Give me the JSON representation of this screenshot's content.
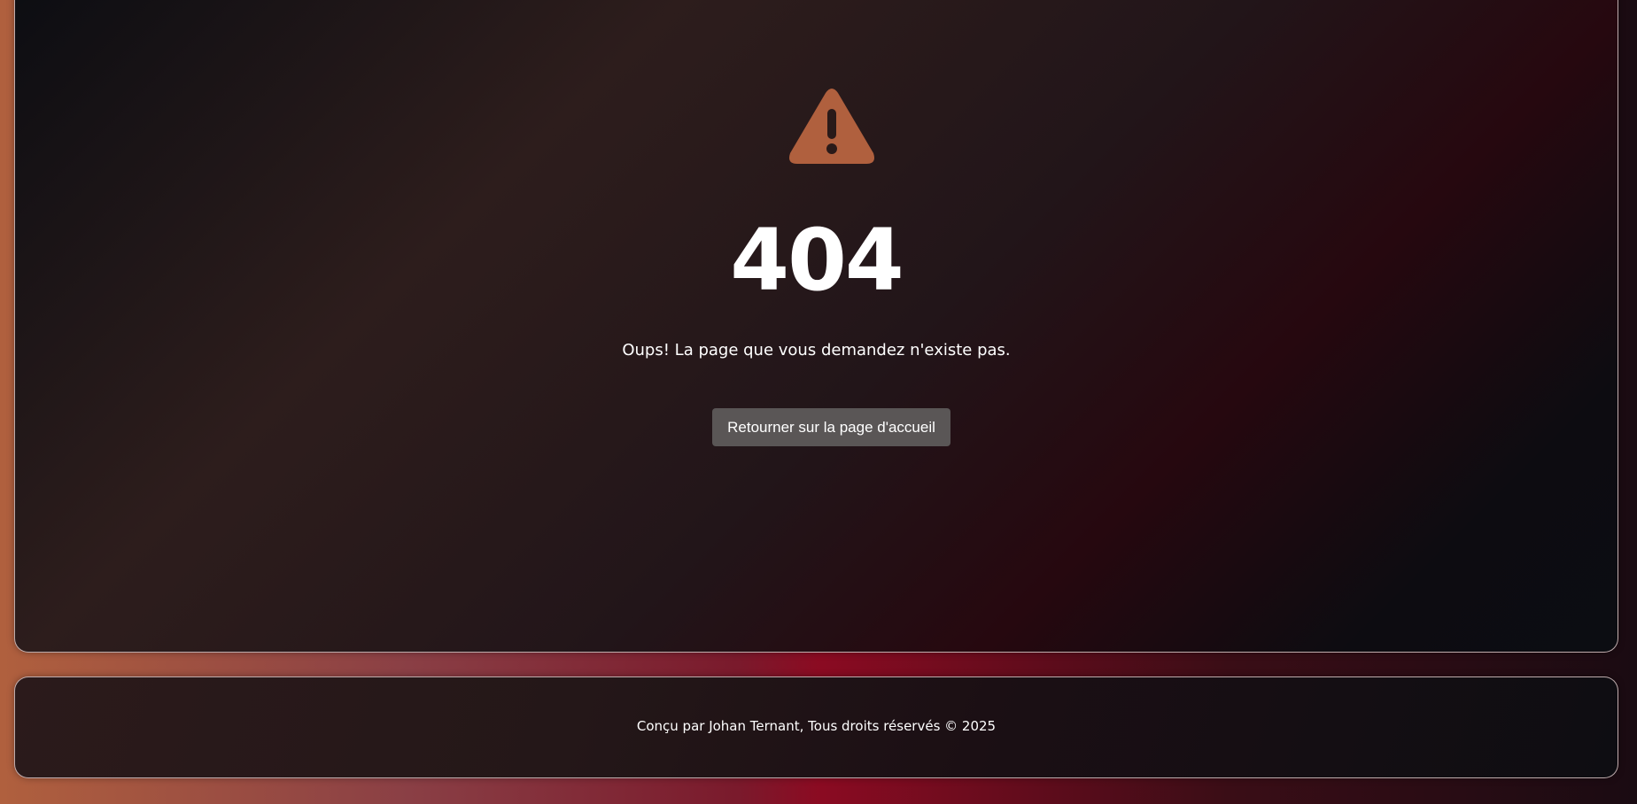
{
  "error": {
    "icon": "warning-triangle-icon",
    "code": "404",
    "message": "Oups! La page que vous demandez n'existe pas.",
    "home_button_label": "Retourner sur la page d'accueil"
  },
  "footer": {
    "text": "Conçu par Johan Ternant, Tous droits réservés © 2025"
  },
  "colors": {
    "icon": "#b0603e",
    "button_bg": "#5a5656",
    "text": "#ffffff"
  }
}
